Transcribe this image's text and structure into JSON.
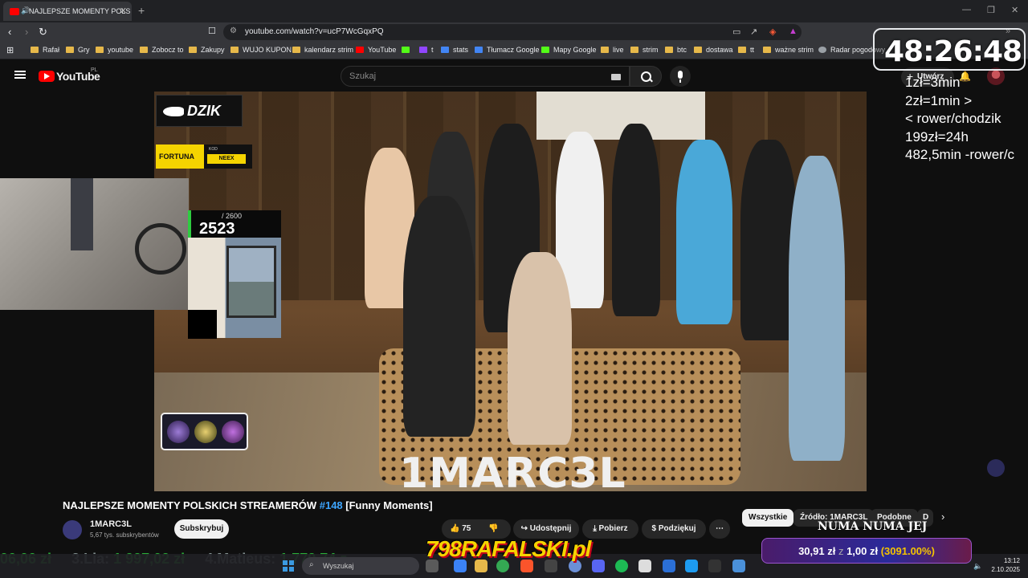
{
  "browser": {
    "tab_title": "NAJLEPSZE MOMENTY POLS",
    "url": "youtube.com/watch?v=ucP7WcGqxPQ",
    "bookmarks": [
      {
        "label": "Rafał",
        "icon": "folder"
      },
      {
        "label": "Gry",
        "icon": "folder"
      },
      {
        "label": "youtube",
        "icon": "folder"
      },
      {
        "label": "Zobocz to",
        "icon": "folder"
      },
      {
        "label": "Zakupy",
        "icon": "folder"
      },
      {
        "label": "WUJO KUPON",
        "icon": "folder"
      },
      {
        "label": "kalendarz strim",
        "icon": "folder"
      },
      {
        "label": "YouTube",
        "icon": "youtube"
      },
      {
        "label": "",
        "icon": "kick"
      },
      {
        "label": "t",
        "icon": "twitch"
      },
      {
        "label": "stats",
        "icon": "stats"
      },
      {
        "label": "Tłumacz Google",
        "icon": "translate"
      },
      {
        "label": "Mapy Google",
        "icon": "maps"
      },
      {
        "label": "live",
        "icon": "folder"
      },
      {
        "label": "strim",
        "icon": "folder"
      },
      {
        "label": "btc",
        "icon": "folder"
      },
      {
        "label": "dostawa",
        "icon": "folder"
      },
      {
        "label": "tt",
        "icon": "folder"
      },
      {
        "label": "ważne strim",
        "icon": "folder"
      },
      {
        "label": "Radar pogodowy",
        "icon": "globe"
      }
    ]
  },
  "youtube": {
    "logo_text": "YouTube",
    "region": "PL",
    "search_placeholder": "Szukaj",
    "create_label": "Utwórz"
  },
  "video": {
    "watermark": "1MARC3L",
    "title_main": "NAJLEPSZE MOMENTY POLSKICH STREAMERÓW ",
    "title_tag": "#148",
    "title_suffix": " [Funny Moments]",
    "channel_name": "1MARC3L",
    "channel_subs": "5,67 tys. subskrybentów",
    "subscribe_label": "Subskrybuj",
    "likes": "75",
    "share_label": "Udostępnij",
    "download_label": "Pobierz",
    "thanks_label": "Podziękuj",
    "chips": [
      "Wszystkie",
      "Źródło: 1MARC3L",
      "Podobne",
      "D"
    ]
  },
  "overlay": {
    "timer": "48:26:48",
    "notes": [
      "1zł=3min",
      "2zł=1min >",
      "< rower/chodzik",
      "199zł=24h",
      "482,5min -rower/c"
    ],
    "dzik_label": "DZIK",
    "fortuna_label": "FORTUNA",
    "fortuna_code_label": "KOD",
    "fortuna_code": "NEEX",
    "counter_max": "/ 2600",
    "counter_value": "2523",
    "ticker": [
      {
        "rank": "",
        "name": "",
        "amount": "06,06 zł"
      },
      {
        "rank": "3.",
        "name": "Lia:",
        "amount": "1 997,02 zł"
      },
      {
        "rank": "4.",
        "name": "Matieus:",
        "amount": "1 779,74 z"
      }
    ],
    "rafalski_banner": "798RAFALSKI.pl",
    "numa": "NUMA NUMA JEJ",
    "donation_amount": "30,91 zł",
    "donation_from": " z ",
    "donation_goal": "1,00 zł",
    "donation_pct": "(3091.00%)"
  },
  "taskbar": {
    "search_placeholder": "Wyszukaj",
    "time": "13:12",
    "date": "2.10.2025"
  },
  "colors": {
    "accent": "#3ea6ff",
    "youtube_red": "#ff0000",
    "ticker_green": "#2ecc40",
    "fortuna_yellow": "#f5d400"
  }
}
